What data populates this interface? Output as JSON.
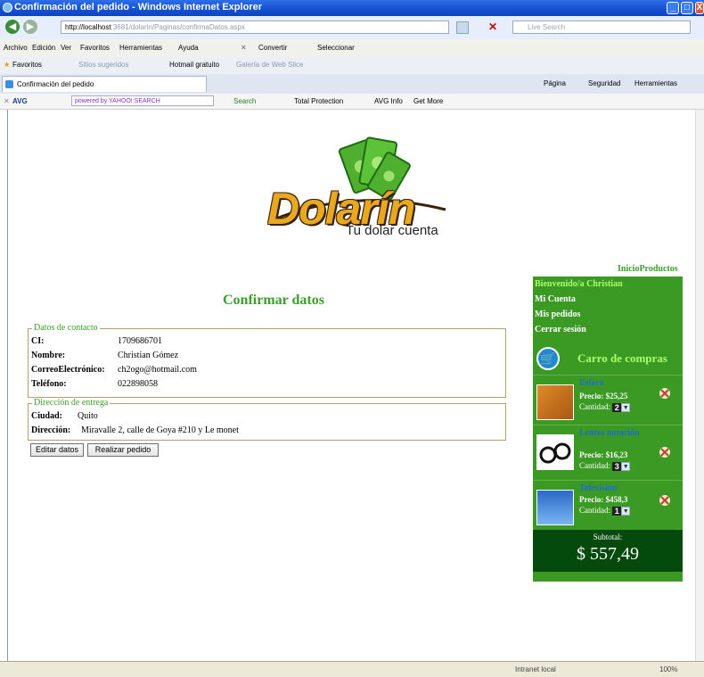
{
  "window": {
    "title": "Confirmación del pedido - Windows Internet Explorer",
    "minimize": "_",
    "maximize": "□",
    "close": "X"
  },
  "browser": {
    "address_host": "http://localhost",
    "address_rest": ":3681/dolarin/Paginas/confirmaDatos.aspx",
    "live_search": "Live Search",
    "menu": [
      "Archivo",
      "Edición",
      "Ver",
      "Favoritos",
      "Herramientas",
      "Ayuda"
    ],
    "convert": "Convertir",
    "select": "Seleccionar",
    "favorites": "Favoritos",
    "fav_items": [
      "Sitios sugeridos",
      "Hotmail gratuito",
      "Galería de Web Slice"
    ],
    "tab_title": "Confirmación del pedido",
    "tools": [
      "Página",
      "Seguridad",
      "Herramientas"
    ],
    "avg": {
      "brand": "AVG",
      "search_placeholder": "powered by YAHOO! SEARCH",
      "search_btn": "Search",
      "items": [
        "Total Protection",
        "AVG Info",
        "Get More"
      ]
    },
    "status": {
      "zone": "Intranet local",
      "zoom": "100%"
    }
  },
  "site": {
    "logo_text": "Dolarín",
    "logo_tagline": "Tu dolar cuenta",
    "top_nav": "InicioProductos",
    "page_title": "Confirmar datos"
  },
  "contact": {
    "legend": "Datos de contacto",
    "rows": [
      {
        "label": "CI:",
        "value": "1709686701"
      },
      {
        "label": "Nombre:",
        "value": "Christian Gómez"
      },
      {
        "label": "CorreoElectrónico:",
        "value": "ch2ogo@hotmail.com"
      },
      {
        "label": "Teléfono:",
        "value": "022898058"
      }
    ]
  },
  "delivery": {
    "legend": "Dirección de entrega",
    "city_label": "Ciudad:",
    "city": "Quito",
    "address_label": "Dirección:",
    "address": "Miravalle 2, calle de Goya #210 y Le monet"
  },
  "actions": {
    "edit": "Editar datos",
    "submit": "Realizar pedido"
  },
  "sidebar": {
    "welcome": "Bienvenido/a Christian",
    "links": [
      "Mi Cuenta",
      "Mis pedidos",
      "Cerrar sesión"
    ],
    "cart_title": "Carro de compras",
    "items": [
      {
        "name": "Esfero",
        "price": "Precio: $25,25",
        "qty_label": "Cantidad:",
        "qty": "2"
      },
      {
        "name": "Lentes natación",
        "price": "Precio: $16,23",
        "qty_label": "Cantidad:",
        "qty": "3"
      },
      {
        "name": "Televisión",
        "price": "Precio: $458,3",
        "qty_label": "Cantidad:",
        "qty": "1"
      }
    ],
    "subtotal_label": "Subtotal:",
    "subtotal_value": "$ 557,49"
  },
  "colors": {
    "accent_green": "#3aa02a",
    "sidebar_green": "#3a9a24",
    "subtotal_bg": "#034a0c",
    "item_name_blue": "#1e6bd8"
  }
}
